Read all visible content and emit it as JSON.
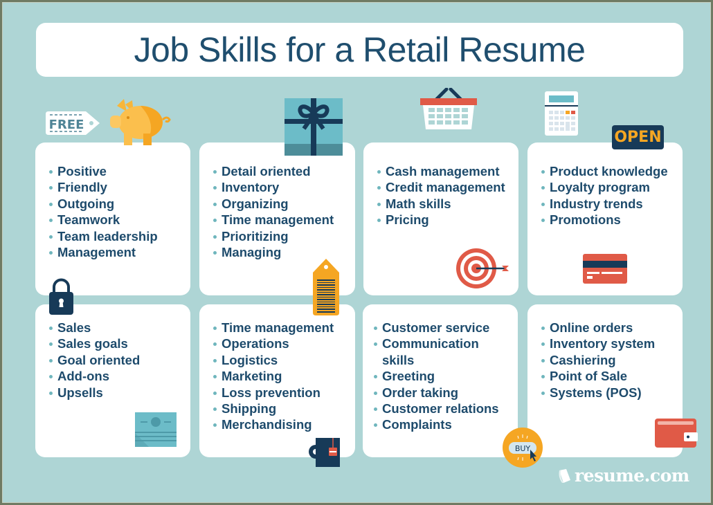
{
  "title": "Job Skills for a Retail Resume",
  "colors": {
    "background": "#aed5d5",
    "title_text": "#1f4e6e",
    "item_text": "#1e4b6c",
    "bullet": "#6fb6bd",
    "orange": "#f5a623",
    "red": "#e05a47",
    "navy": "#173a58"
  },
  "cards": [
    {
      "items": [
        "Positive",
        "Friendly",
        "Outgoing",
        "Teamwork",
        "Team leadership",
        "Management"
      ]
    },
    {
      "items": [
        "Detail oriented",
        "Inventory",
        "Organizing",
        "Time management",
        "Prioritizing",
        "Managing"
      ]
    },
    {
      "items": [
        "Cash management",
        "Credit management",
        "Math skills",
        "Pricing"
      ]
    },
    {
      "items": [
        "Product knowledge",
        "Loyalty program",
        "Industry trends",
        "Promotions"
      ]
    },
    {
      "items": [
        "Sales",
        "Sales goals",
        "Goal oriented",
        "Add-ons",
        "Upsells"
      ]
    },
    {
      "items": [
        "Time management",
        "Operations",
        "Logistics",
        "Marketing",
        "Loss prevention",
        "Shipping",
        "Merchandising"
      ]
    },
    {
      "items": [
        "Customer service",
        "Communication",
        "skills",
        "Greeting",
        "Order taking",
        "Customer relations",
        "Complaints"
      ]
    },
    {
      "items": [
        "Online orders",
        "Inventory system",
        "Cashiering",
        "Point of Sale",
        "Systems (POS)"
      ]
    }
  ],
  "icons": {
    "free_tag_label": "FREE",
    "open_sign_label": "OPEN",
    "buy_button_label": "BUY"
  },
  "logo": {
    "text": "resume.com"
  }
}
